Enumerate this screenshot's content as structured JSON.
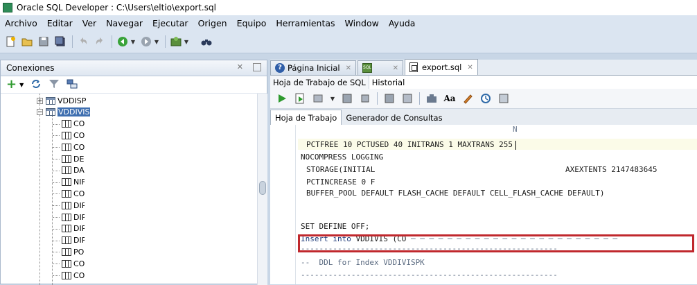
{
  "window": {
    "title": "Oracle SQL Developer : C:\\Users\\eltio\\export.sql"
  },
  "menu": [
    "Archivo",
    "Editar",
    "Ver",
    "Navegar",
    "Ejecutar",
    "Origen",
    "Equipo",
    "Herramientas",
    "Window",
    "Ayuda"
  ],
  "connections_panel": {
    "title": "Conexiones",
    "tree": {
      "tables": [
        "VDDISP",
        "VDDIVIS"
      ],
      "columns": [
        "CO",
        "CO",
        "CO",
        "DES",
        "DAI",
        "NIF",
        "CO",
        "DIR",
        "DIR",
        "DIR",
        "DIR",
        "POE",
        "COI",
        "COI"
      ]
    }
  },
  "doc_tabs": [
    {
      "label": "Página Inicial"
    },
    {
      "label": ""
    },
    {
      "label": "export.sql"
    }
  ],
  "editor_tabs": [
    "Hoja de Trabajo de SQL",
    "Historial"
  ],
  "worksheet_tabs": [
    "Hoja de Trabajo",
    "Generador de Consultas"
  ],
  "code_lines": {
    "l1": "N",
    "l2": "PCTFREE 10 PCTUSED 40 INITRANS 1 MAXTRANS 255",
    "l3": "NOCOMPRESS LOGGING",
    "l4": "STORAGE(INITIAL",
    "l4b": "AXEXTENTS 2147483645",
    "l5": "PCTINCREASE 0 F",
    "l6": "BUFFER_POOL DEFAULT FLASH_CACHE DEFAULT CELL_FLASH_CACHE DEFAULT)",
    "l7": "SET DEFINE OFF;",
    "l8a": "Insert into",
    "l8b": "VDDIVIS (CO",
    "l9": "--  DDL for Index VDDIVISPK",
    "dash": "--------------------------------------------------------"
  },
  "colors": {
    "highlight_box": "#c0282d",
    "keyword": "#1e3a78"
  }
}
